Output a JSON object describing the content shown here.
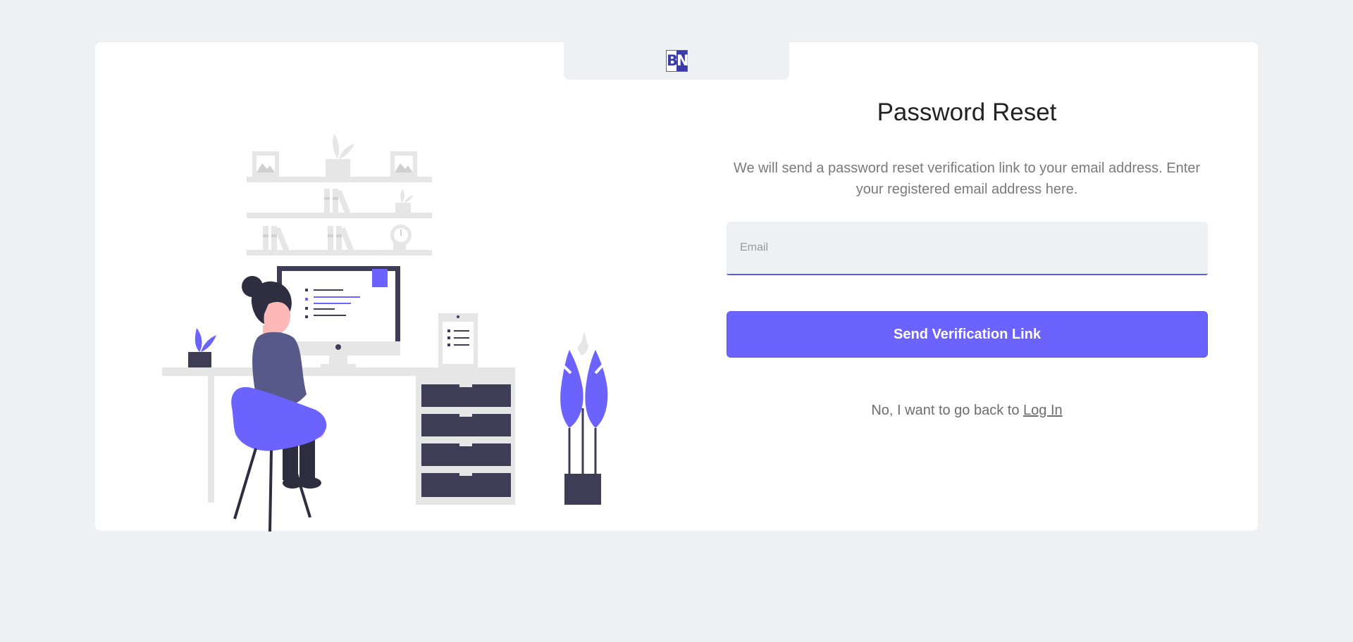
{
  "logo": {
    "letter_left": "B",
    "letter_right": "N"
  },
  "heading": "Password Reset",
  "description": "We will send a password reset verification link to your email address. Enter your registered email address here.",
  "email_field": {
    "placeholder": "Email",
    "value": ""
  },
  "submit_label": "Send Verification Link",
  "back": {
    "prefix": "No, I want to go back to ",
    "link_label": "Log In"
  },
  "colors": {
    "background": "#edf1f3",
    "accent": "#6c63ff",
    "dark": "#3f3d56",
    "card": "#ffffff"
  }
}
